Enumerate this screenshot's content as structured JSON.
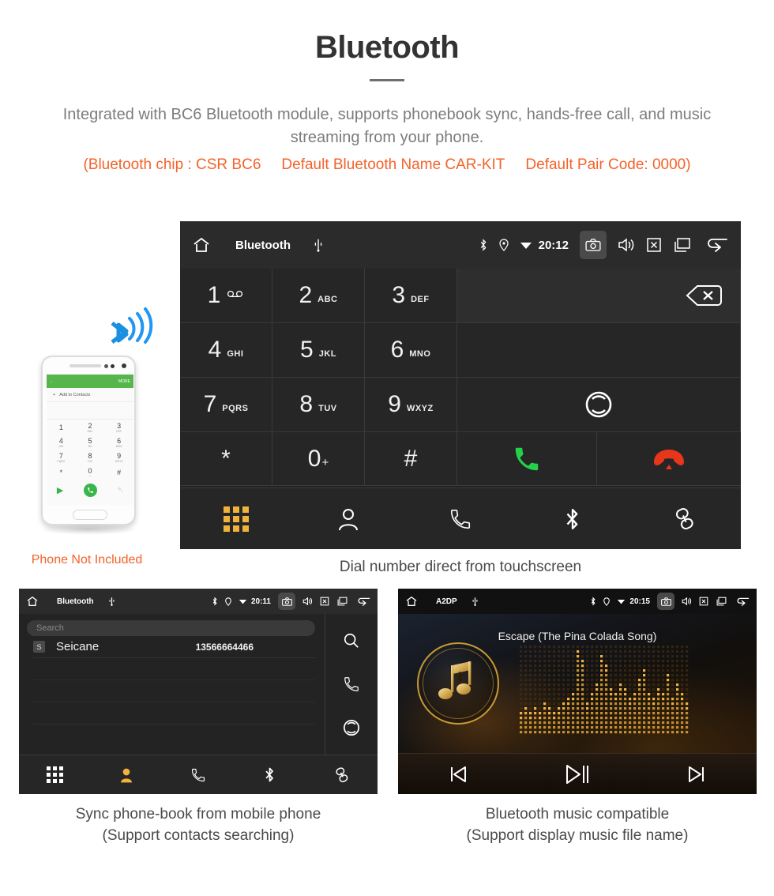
{
  "header": {
    "title": "Bluetooth",
    "description": "Integrated with BC6 Bluetooth module, supports phonebook sync, hands-free call, and music streaming from your phone.",
    "spec_open": "(Bluetooth chip : CSR BC6",
    "spec_name": "Default Bluetooth Name CAR-KIT",
    "spec_code": "Default Pair Code: 0000)"
  },
  "phone_illustration": {
    "note": "Phone Not Included",
    "appbar_more": "MORE",
    "add_contact": "Add to Contacts",
    "keys": [
      {
        "digit": "1",
        "sub": ""
      },
      {
        "digit": "2",
        "sub": "ABC"
      },
      {
        "digit": "3",
        "sub": "DEF"
      },
      {
        "digit": "4",
        "sub": "GHI"
      },
      {
        "digit": "5",
        "sub": "JKL"
      },
      {
        "digit": "6",
        "sub": "MNO"
      },
      {
        "digit": "7",
        "sub": "PQRS"
      },
      {
        "digit": "8",
        "sub": "TUV"
      },
      {
        "digit": "9",
        "sub": "WXYZ"
      },
      {
        "digit": "*",
        "sub": ""
      },
      {
        "digit": "0",
        "sub": "+"
      },
      {
        "digit": "#",
        "sub": ""
      }
    ]
  },
  "main_unit": {
    "statusbar": {
      "title": "Bluetooth",
      "clock": "20:12",
      "icons": [
        "home-icon",
        "usb-icon",
        "bluetooth-icon",
        "location-icon",
        "wifi-icon",
        "camera-icon",
        "volume-icon",
        "close-icon",
        "recents-icon",
        "back-icon"
      ]
    },
    "keypad": [
      {
        "digit": "1",
        "sub": "",
        "voicemail": true
      },
      {
        "digit": "2",
        "sub": "ABC"
      },
      {
        "digit": "3",
        "sub": "DEF"
      },
      {
        "digit": "4",
        "sub": "GHI"
      },
      {
        "digit": "5",
        "sub": "JKL"
      },
      {
        "digit": "6",
        "sub": "MNO"
      },
      {
        "digit": "7",
        "sub": "PQRS"
      },
      {
        "digit": "8",
        "sub": "TUV"
      },
      {
        "digit": "9",
        "sub": "WXYZ"
      },
      {
        "digit": "*",
        "sub": ""
      },
      {
        "digit": "0",
        "sub": "+"
      },
      {
        "digit": "#",
        "sub": ""
      }
    ],
    "number_display": "",
    "nav": [
      "keypad-icon",
      "contacts-icon",
      "call-log-icon",
      "bluetooth-icon",
      "link-icon"
    ],
    "active_nav": "keypad-icon",
    "caption": "Dial number direct from touchscreen"
  },
  "phonebook_unit": {
    "statusbar": {
      "title": "Bluetooth",
      "clock": "20:11"
    },
    "search_placeholder": "Search",
    "columns": [
      "name",
      "number"
    ],
    "contacts": [
      {
        "initial": "S",
        "name": "Seicane",
        "number": "13566664466"
      }
    ],
    "empty_rows": 4,
    "side_actions": [
      "search-icon",
      "call-icon",
      "sync-icon"
    ],
    "nav": [
      "keypad-icon",
      "contacts-icon",
      "call-log-icon",
      "bluetooth-icon",
      "link-icon"
    ],
    "active_nav": "contacts-icon",
    "caption_line1": "Sync phone-book from mobile phone",
    "caption_line2": "(Support contacts searching)"
  },
  "music_unit": {
    "statusbar": {
      "title": "A2DP",
      "clock": "20:15"
    },
    "song_title": "Escape (The Pina Colada Song)",
    "transport": [
      "previous-track-icon",
      "play-pause-icon",
      "next-track-icon"
    ],
    "caption_line1": "Bluetooth music compatible",
    "caption_line2": "(Support display music file name)"
  },
  "colors": {
    "accent_orange": "#f4622a",
    "nav_active_amber": "#f0b23c",
    "call_green": "#24d14b",
    "end_red": "#e8361a",
    "unit_dark": "#232323",
    "gold": "#c99a33"
  }
}
